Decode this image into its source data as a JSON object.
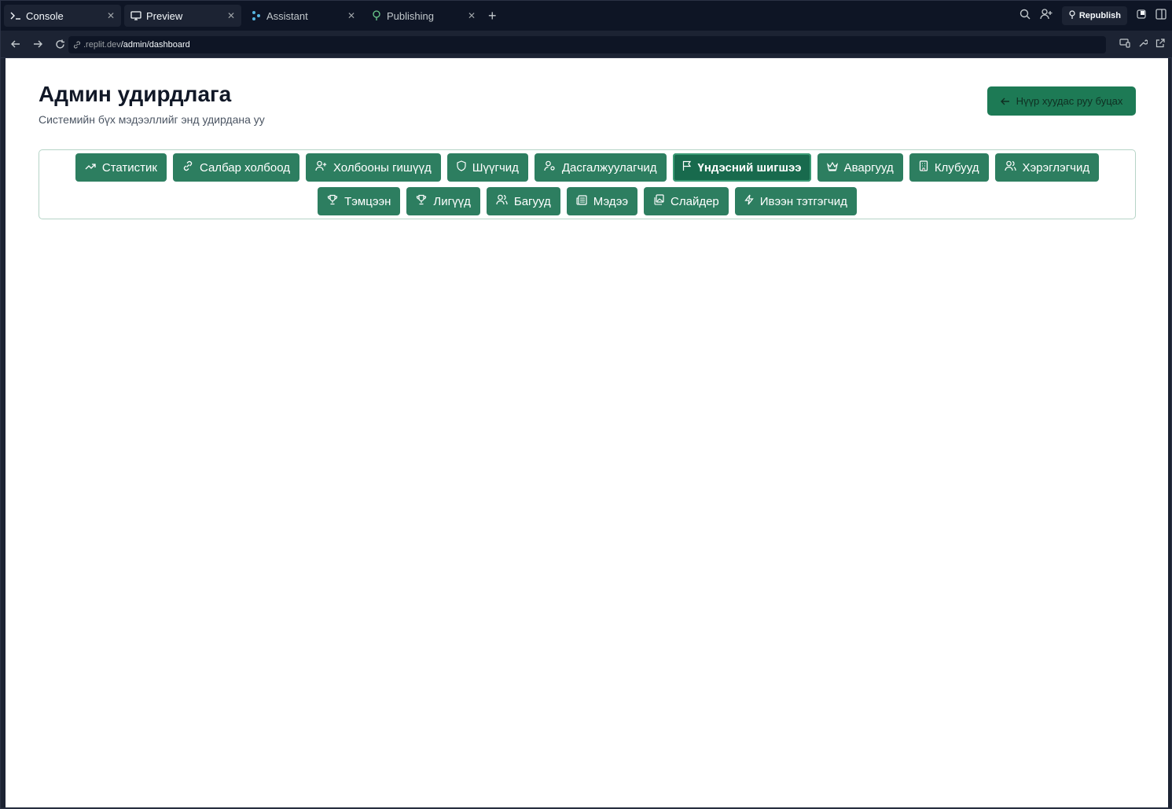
{
  "tabs": [
    {
      "label": "Console",
      "icon": "terminal-icon",
      "active": true
    },
    {
      "label": "Preview",
      "icon": "monitor-icon",
      "active": true
    },
    {
      "label": "Assistant",
      "icon": "assistant-icon",
      "active": false
    },
    {
      "label": "Publishing",
      "icon": "publishing-icon",
      "active": false
    }
  ],
  "toolbar": {
    "republish_label": "Republish"
  },
  "address": {
    "domain": ".replit.dev",
    "path": "/admin/dashboard"
  },
  "page": {
    "title": "Админ удирдлага",
    "subtitle": "Системийн бүх мэдээллийг энд удирдана уу",
    "back_label": "Нүүр хуудас руу буцах"
  },
  "nav": {
    "row1": [
      {
        "label": "Статистик",
        "icon": "trending-up-icon"
      },
      {
        "label": "Салбар холбоод",
        "icon": "link-icon"
      },
      {
        "label": "Холбооны гишүүд",
        "icon": "user-plus-icon"
      },
      {
        "label": "Шүүгчид",
        "icon": "shield-icon"
      },
      {
        "label": "Дасгалжуулагчид",
        "icon": "user-cog-icon"
      },
      {
        "label": "Үндэсний шигшээ",
        "icon": "flag-icon",
        "active": true
      },
      {
        "label": "Аваргууд",
        "icon": "crown-icon"
      },
      {
        "label": "Клубууд",
        "icon": "building-icon"
      },
      {
        "label": "Хэрэглэгчид",
        "icon": "users-icon"
      }
    ],
    "row2": [
      {
        "label": "Тэмцээн",
        "icon": "trophy-icon"
      },
      {
        "label": "Лигүүд",
        "icon": "trophy-icon"
      },
      {
        "label": "Багууд",
        "icon": "users-icon"
      },
      {
        "label": "Мэдээ",
        "icon": "newspaper-icon"
      },
      {
        "label": "Слайдер",
        "icon": "images-icon"
      },
      {
        "label": "Ивээн тэтгэгчид",
        "icon": "zap-icon"
      }
    ]
  },
  "colors": {
    "button": "#2d7e60",
    "button_active": "#186a4d",
    "back_button": "#1d7a55"
  }
}
